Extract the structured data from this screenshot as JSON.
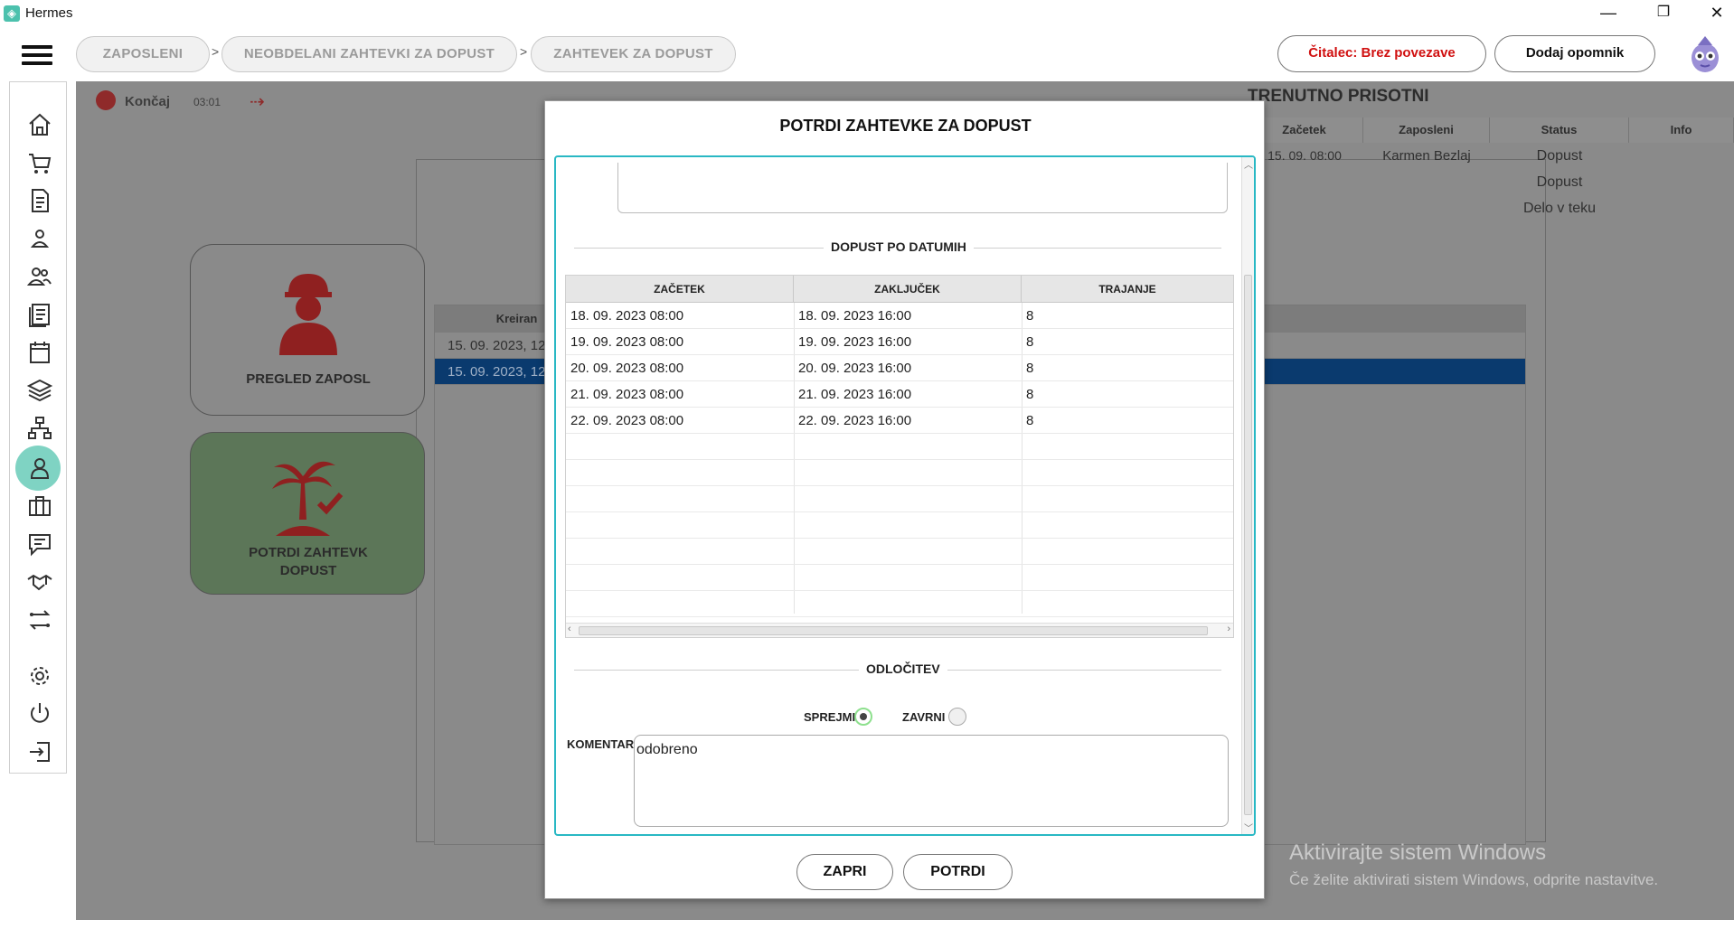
{
  "window": {
    "title": "Hermes",
    "minimize": "—",
    "restore": "❐",
    "close": "✕"
  },
  "breadcrumb": [
    {
      "label": "ZAPOSLENI"
    },
    {
      "label": "NEOBDELANI ZAHTEVKI ZA DOPUST"
    },
    {
      "label": "ZAHTEVEK ZA DOPUST"
    }
  ],
  "breadcrumb_separator": ">",
  "header": {
    "reader_status": "Čitalec: Brez povezave",
    "reader_status_color": "#d01010",
    "add_reminder": "Dodaj opomnik"
  },
  "sidebar": {
    "items": [
      {
        "icon": "home-icon"
      },
      {
        "icon": "cart-icon"
      },
      {
        "icon": "document-icon"
      },
      {
        "icon": "person-icon"
      },
      {
        "icon": "people-icon"
      },
      {
        "icon": "list-icon"
      },
      {
        "icon": "calendar-icon"
      },
      {
        "icon": "layers-icon"
      },
      {
        "icon": "network-icon"
      },
      {
        "icon": "employee-icon",
        "active": true
      },
      {
        "icon": "briefcase-icon"
      },
      {
        "icon": "chat-icon"
      },
      {
        "icon": "handshake-icon"
      },
      {
        "icon": "transfer-icon"
      },
      {
        "icon": "gear-icon"
      },
      {
        "icon": "power-icon"
      },
      {
        "icon": "logout-icon"
      }
    ],
    "active_color": "#7fd3c3"
  },
  "background": {
    "toolbar": {
      "end_label": "Končaj",
      "timer": "03:01"
    },
    "cards": [
      {
        "label": "PREGLED ZAPOSL"
      },
      {
        "label": "POTRDI ZAHTEVK",
        "label2": "DOPUST"
      }
    ],
    "requests_table": {
      "header": "Kreiran",
      "rows": [
        "15. 09. 2023, 12:32:06",
        "15. 09. 2023, 12:40:43"
      ]
    },
    "present_panel": {
      "title": "TRENUTNO PRISOTNI",
      "columns": [
        "Začetek",
        "Zaposleni",
        "Status",
        "Info"
      ],
      "rows": [
        {
          "start": "15. 09.  08:00",
          "employee": "Karmen Bezlaj",
          "status": "Dopust"
        },
        {
          "start": "",
          "employee": "",
          "status": "Dopust"
        },
        {
          "start": "",
          "employee": "",
          "status": "Delo v teku"
        }
      ]
    },
    "watermark": {
      "line1": "Aktivirajte sistem Windows",
      "line2": "Če želite aktivirati sistem Windows, odprite nastavitve."
    }
  },
  "modal": {
    "title": "POTRDI ZAHTEVKE ZA DOPUST",
    "accent_color": "#29b8c4",
    "dates_section": "DOPUST PO DATUMIH",
    "columns": [
      "ZAČETEK",
      "ZAKLJUČEK",
      "TRAJANJE"
    ],
    "rows": [
      {
        "start": "18. 09. 2023 08:00",
        "end": "18. 09. 2023 16:00",
        "duration": "8"
      },
      {
        "start": "19. 09. 2023 08:00",
        "end": "19. 09. 2023 16:00",
        "duration": "8"
      },
      {
        "start": "20. 09. 2023 08:00",
        "end": "20. 09. 2023 16:00",
        "duration": "8"
      },
      {
        "start": "21. 09. 2023 08:00",
        "end": "21. 09. 2023 16:00",
        "duration": "8"
      },
      {
        "start": "22. 09. 2023 08:00",
        "end": "22. 09. 2023 16:00",
        "duration": "8"
      }
    ],
    "decision_section": "ODLOČITEV",
    "accept_label": "SPREJMI",
    "reject_label": "ZAVRNI",
    "selected": "SPREJMI",
    "comment_label": "KOMENTAR",
    "comment_value": "odobreno",
    "close_button": "ZAPRI",
    "confirm_button": "POTRDI"
  }
}
